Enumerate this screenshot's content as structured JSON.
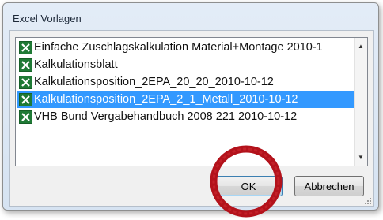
{
  "dialog": {
    "title": "Excel Vorlagen"
  },
  "list": {
    "items": [
      {
        "label": "Einfache Zuschlagskalkulation Material+Montage 2010-1",
        "icon": "excel-file-icon",
        "selected": false
      },
      {
        "label": "Kalkulationsblatt",
        "icon": "excel-file-icon",
        "selected": false
      },
      {
        "label": "Kalkulationsposition_2EPA_20_20_2010-10-12",
        "icon": "excel-file-icon",
        "selected": false
      },
      {
        "label": "Kalkulationsposition_2EPA_2_1_Metall_2010-10-12",
        "icon": "excel-file-icon",
        "selected": true
      },
      {
        "label": "VHB Bund Vergabehandbuch 2008 221 2010-10-12",
        "icon": "excel-file-icon",
        "selected": false
      }
    ]
  },
  "buttons": {
    "ok_label": "OK",
    "cancel_label": "Abbrechen"
  },
  "colors": {
    "selection": "#3399ff",
    "annotation_ring": "#b3121b",
    "excel_green": "#1f7a35"
  }
}
